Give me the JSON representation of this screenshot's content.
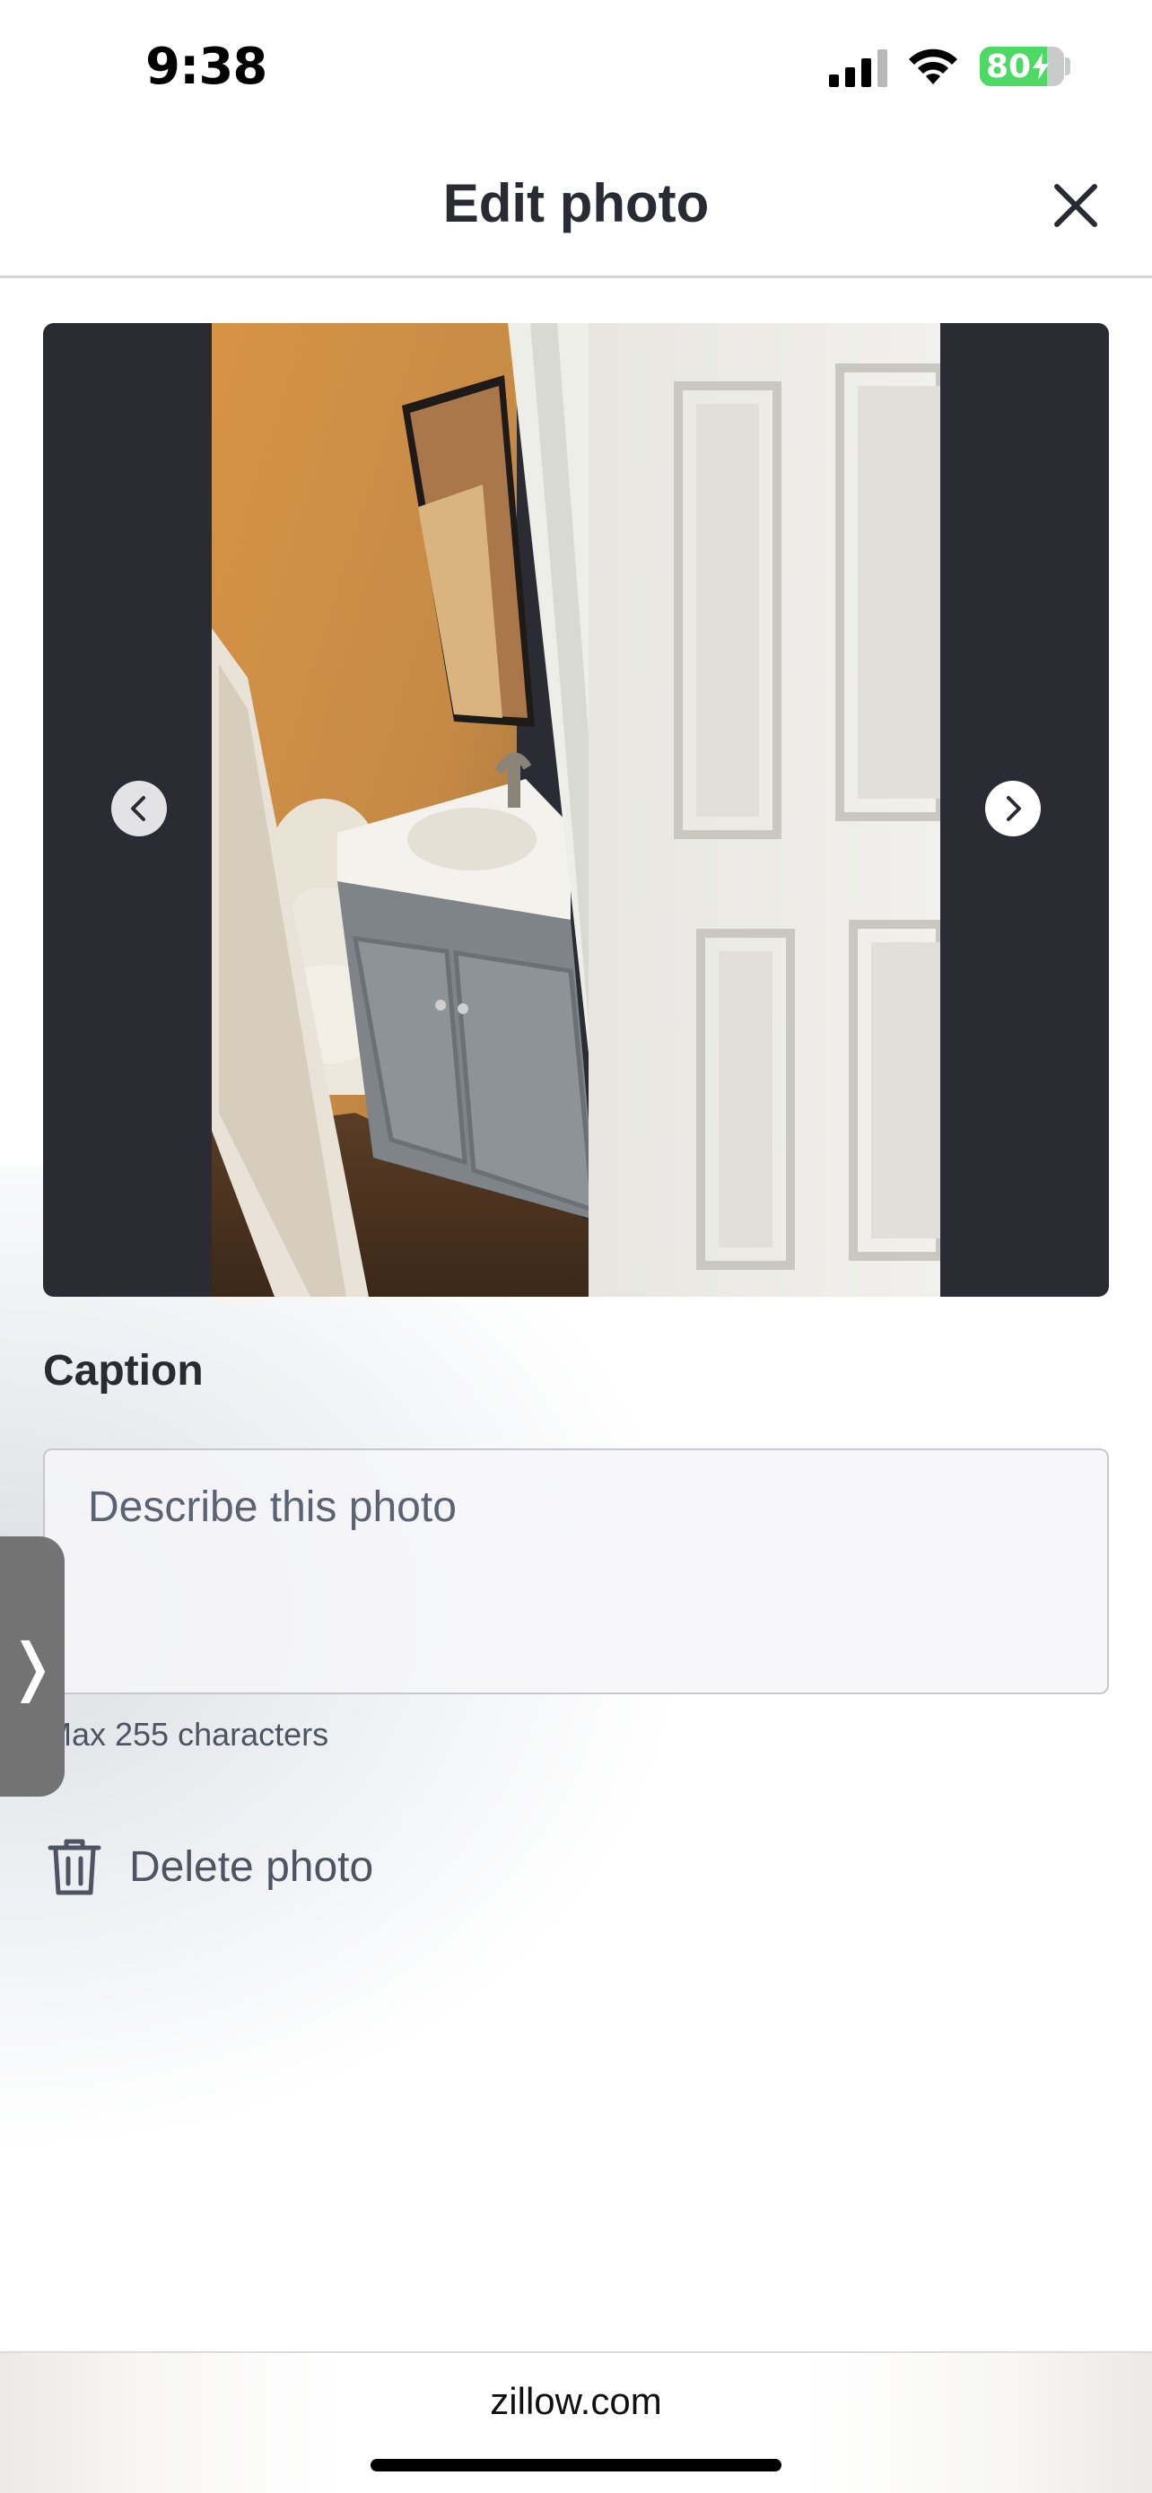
{
  "status_bar": {
    "time": "9:38",
    "battery_percent": "80",
    "battery_level": 0.8,
    "battery_color": "#4cd964",
    "icons": [
      "cellular-signal-icon",
      "wifi-icon",
      "battery-charging-icon"
    ]
  },
  "header": {
    "title": "Edit photo",
    "close_icon": "close-x-icon"
  },
  "photo_viewer": {
    "prev_icon": "chevron-left-icon",
    "next_icon": "chevron-right-icon",
    "background_color": "#2b2c33"
  },
  "caption": {
    "label": "Caption",
    "placeholder": "Describe this photo",
    "value": "",
    "hint": "Max 255 characters"
  },
  "delete": {
    "label": "Delete photo",
    "icon": "trash-icon"
  },
  "side_handle": {
    "glyph": "❭"
  },
  "browser": {
    "url": "zillow.com"
  }
}
